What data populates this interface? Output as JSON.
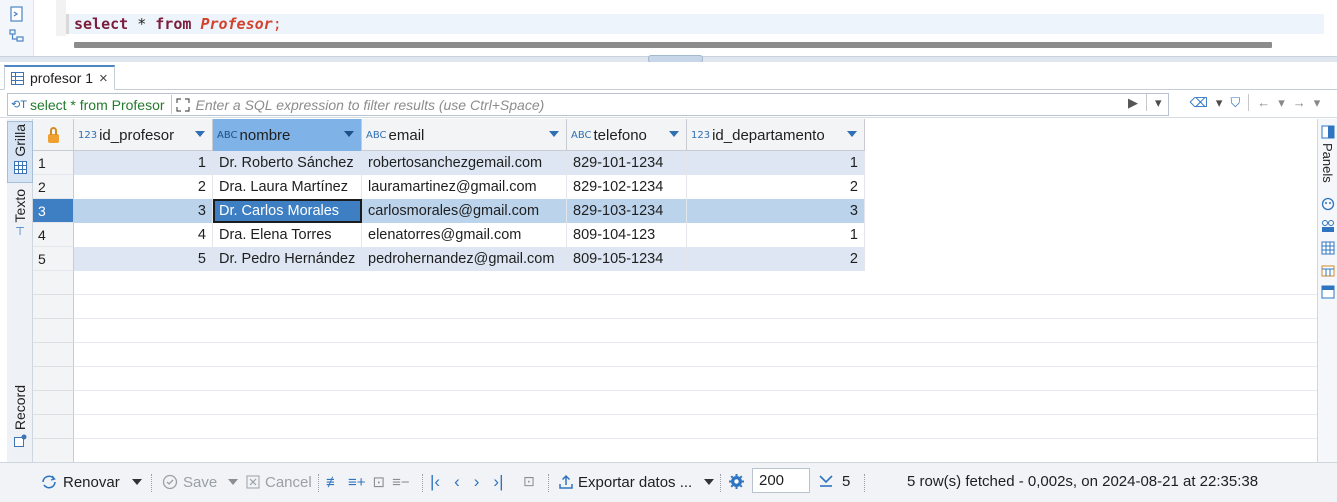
{
  "editor": {
    "sql_select": "select",
    "sql_star": " * ",
    "sql_from": "from",
    "sql_table": "Profesor",
    "sql_semicolon": ";"
  },
  "tab": {
    "label": "profesor 1",
    "close": "×"
  },
  "filter": {
    "query_label": "select * from Profesor",
    "placeholder": "Enter a SQL expression to filter results (use Ctrl+Space)"
  },
  "side_tabs": {
    "grid": "Grilla",
    "text": "Texto",
    "record": "Record"
  },
  "right_panel": {
    "label": "Panels"
  },
  "grid": {
    "columns": [
      {
        "type": "123",
        "name": "id_profesor"
      },
      {
        "type": "ABC",
        "name": "nombre"
      },
      {
        "type": "ABC",
        "name": "email"
      },
      {
        "type": "ABC",
        "name": "telefono"
      },
      {
        "type": "123",
        "name": "id_departamento"
      }
    ],
    "rows": [
      {
        "num": "1",
        "id_profesor": "1",
        "nombre": "Dr. Roberto Sánchez",
        "email": "robertosanchezgemail.com",
        "telefono": "829-101-1234",
        "id_departamento": "1"
      },
      {
        "num": "2",
        "id_profesor": "2",
        "nombre": "Dra. Laura Martínez",
        "email": "lauramartinez@gmail.com",
        "telefono": "829-102-1234",
        "id_departamento": "2"
      },
      {
        "num": "3",
        "id_profesor": "3",
        "nombre": "Dr. Carlos Morales",
        "email": "carlosmorales@gmail.com",
        "telefono": "829-103-1234",
        "id_departamento": "3"
      },
      {
        "num": "4",
        "id_profesor": "4",
        "nombre": "Dra. Elena Torres",
        "email": "elenatorres@gmail.com",
        "telefono": "809-104-123",
        "id_departamento": "1"
      },
      {
        "num": "5",
        "id_profesor": "5",
        "nombre": "Dr. Pedro Hernández",
        "email": "pedrohernandez@gmail.com",
        "telefono": "809-105-1234",
        "id_departamento": "2"
      }
    ]
  },
  "toolbar": {
    "refresh": "Renovar",
    "save": "Save",
    "cancel": "Cancel",
    "export": "Exportar datos ...",
    "fetch_size": "200",
    "row_count": "5",
    "status": "5 row(s) fetched - 0,002s, on 2024-08-21 at 22:35:38"
  },
  "colors": {
    "accent": "#2f74c0",
    "selected_row": "#bcd3ec",
    "focused_cell": "#3e7ec2",
    "active_header": "#7fb2e6",
    "stripe_row": "#dde6f2",
    "sql_keyword": "#7a1e3c",
    "sql_table": "#d2422c",
    "filter_query": "#247a2e"
  }
}
